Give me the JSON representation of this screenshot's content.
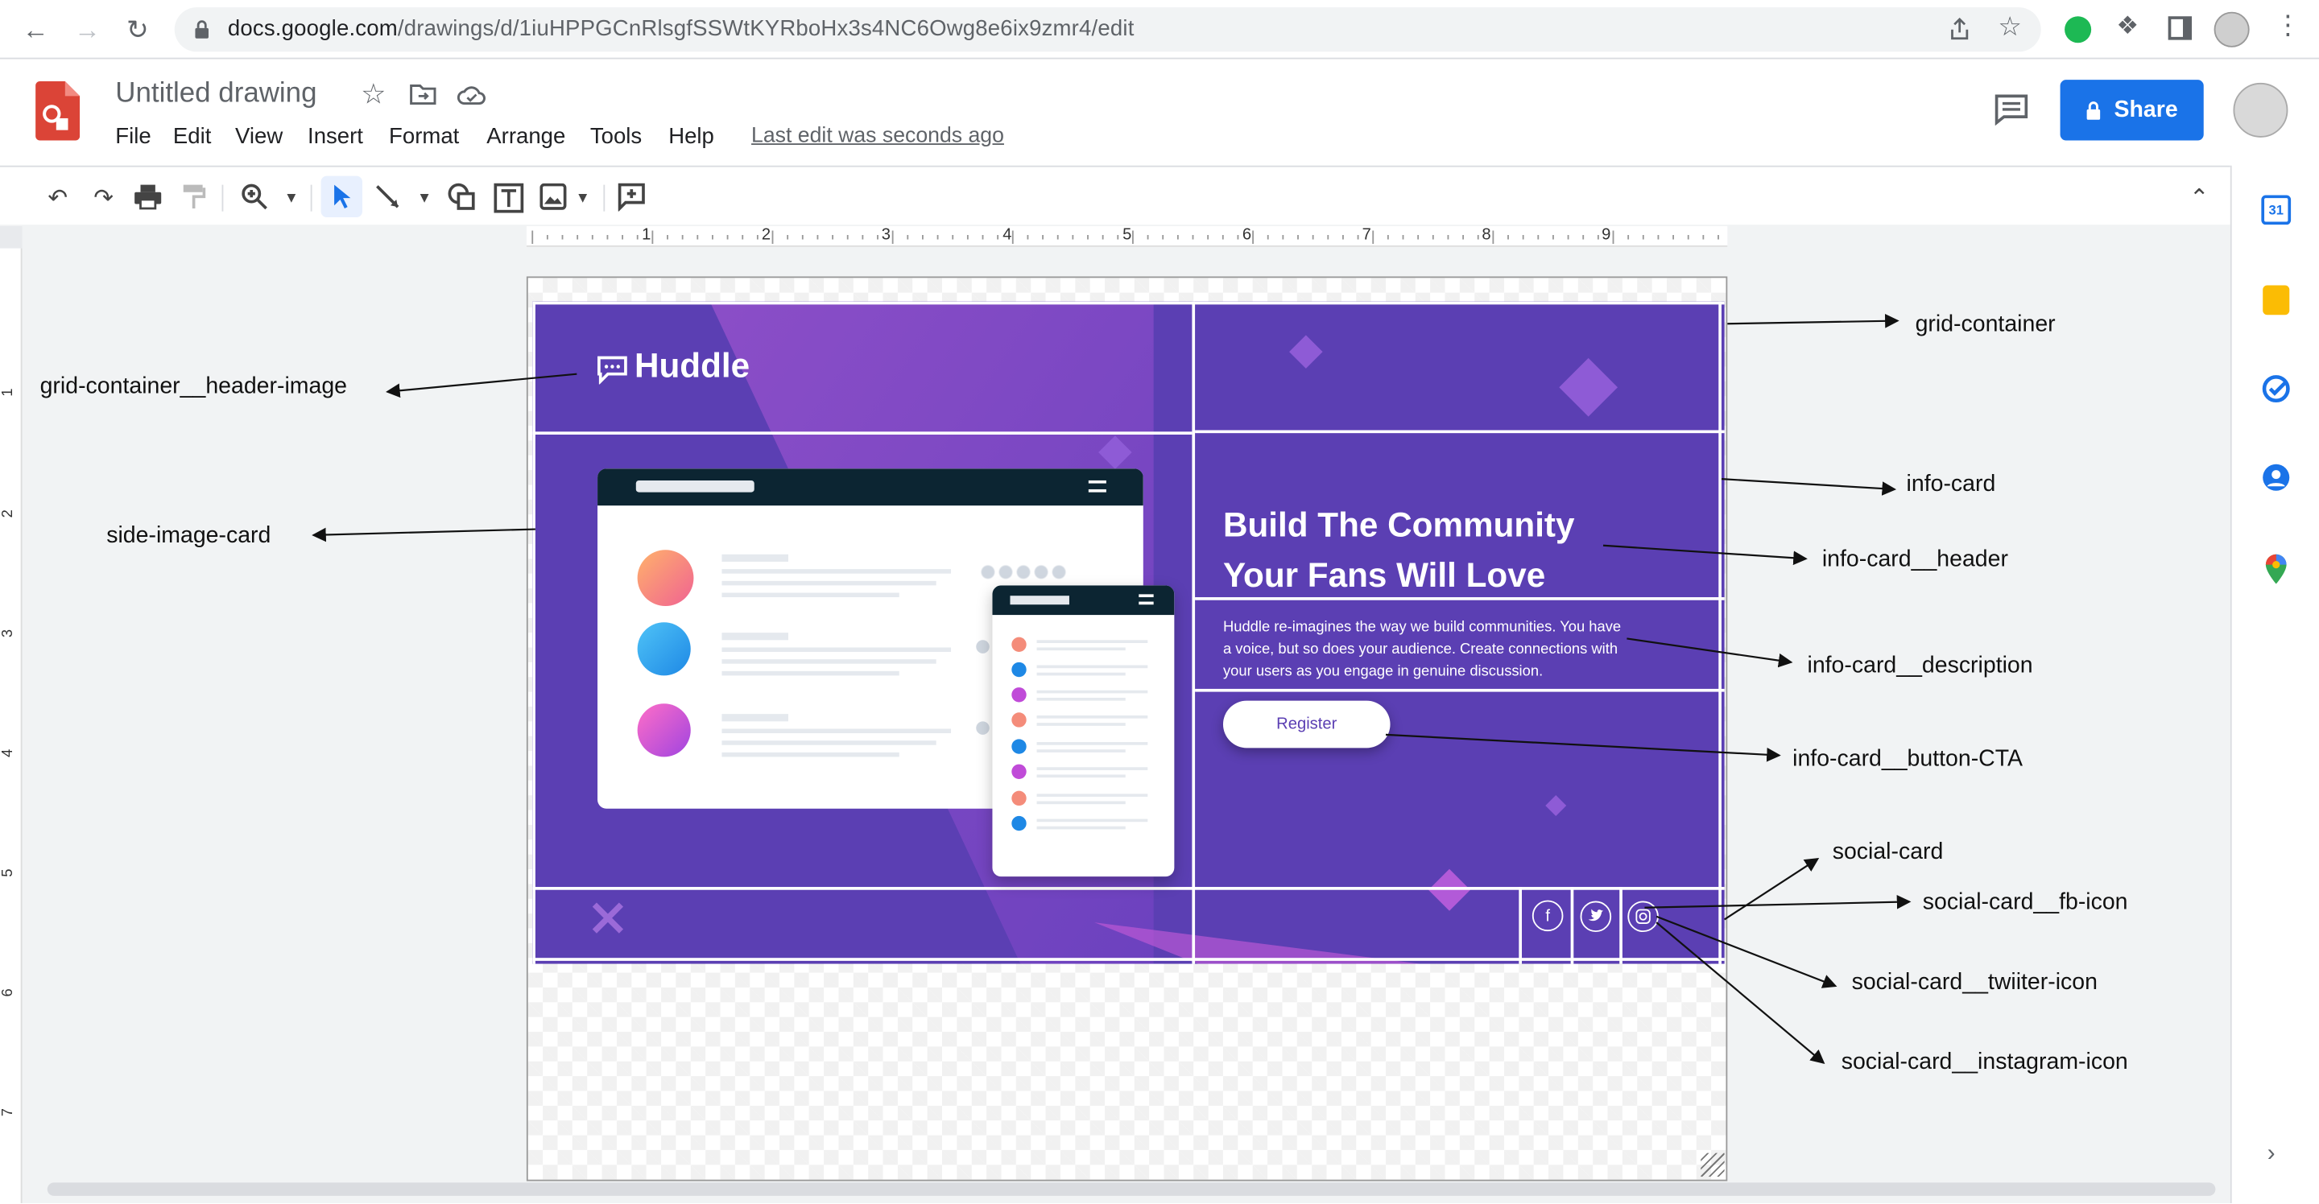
{
  "browser": {
    "url_host": "docs.google.com",
    "url_path": "/drawings/d/1iuHPPGCnRlsgfSSWtKYRboHx3s4NC6Owg8e6ix9zmr4/edit"
  },
  "doc": {
    "title": "Untitled drawing",
    "menu": [
      "File",
      "Edit",
      "View",
      "Insert",
      "Format",
      "Arrange",
      "Tools",
      "Help"
    ],
    "last_edit": "Last edit was seconds ago",
    "share_label": "Share"
  },
  "ruler": {
    "h_ticks": [
      "1",
      "2",
      "3",
      "4",
      "5",
      "6",
      "7",
      "8",
      "9"
    ],
    "v_ticks": [
      "1",
      "2",
      "3",
      "4",
      "5",
      "6",
      "7"
    ]
  },
  "design": {
    "brand": "Huddle",
    "headline_line1": "Build The Community",
    "headline_line2": "Your Fans Will Love",
    "description_line1": "Huddle re-imagines the way we build communities. You have",
    "description_line2": "a voice, but so does your audience. Create connections with",
    "description_line3": "your users as you engage in genuine discussion.",
    "register_label": "Register",
    "colors": {
      "background": "#5b3fb3",
      "accent": "#c85bd8"
    }
  },
  "annotations": {
    "grid_container": "grid-container",
    "header_image": "grid-container__header-image",
    "side_image_card": "side-image-card",
    "info_card": "info-card",
    "info_card_header": "info-card__header",
    "info_card_description": "info-card__description",
    "info_card_button": "info-card__button-CTA",
    "social_card": "social-card",
    "social_fb": "social-card__fb-icon",
    "social_twitter": "social-card__twiiter-icon",
    "social_instagram": "social-card__instagram-icon"
  },
  "icons": [
    "back-icon",
    "forward-icon",
    "reload-icon",
    "lock-icon",
    "share-page-icon",
    "star-icon",
    "extension-icon",
    "puzzle-icon",
    "sidepanel-icon",
    "more-icon",
    "undo-icon",
    "redo-icon",
    "print-icon",
    "paint-format-icon",
    "zoom-icon",
    "select-icon",
    "line-icon",
    "shape-icon",
    "textbox-icon",
    "image-icon",
    "comment-icon",
    "collapse-icon"
  ]
}
